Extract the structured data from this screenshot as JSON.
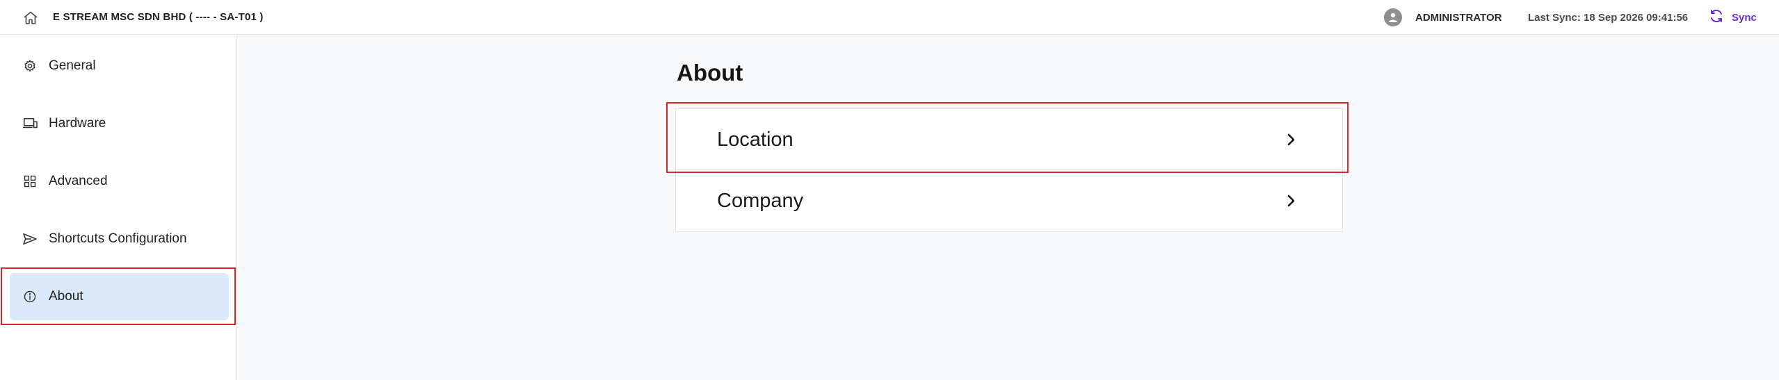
{
  "header": {
    "company_title": "E STREAM MSC SDN BHD ( ---- - SA-T01 )",
    "user_name": "ADMINISTRATOR",
    "last_sync": "Last Sync: 18 Sep 2026 09:41:56",
    "sync_label": "Sync",
    "icons": {
      "home": "home-icon",
      "avatar": "user-avatar-icon",
      "sync": "sync-icon"
    },
    "colors": {
      "sync_accent": "#6b2fd6"
    }
  },
  "sidebar": {
    "items": [
      {
        "label": "General",
        "icon": "gear-icon"
      },
      {
        "label": "Hardware",
        "icon": "devices-icon"
      },
      {
        "label": "Advanced",
        "icon": "grid-icon"
      },
      {
        "label": "Shortcuts Configuration",
        "icon": "send-icon"
      },
      {
        "label": "About",
        "icon": "info-icon",
        "active": true
      }
    ],
    "active_color": "#dbe9fb",
    "highlight_color": "#d62828"
  },
  "main": {
    "title": "About",
    "cards": [
      {
        "label": "Location",
        "icon": "chevron-right-icon",
        "highlighted": true
      },
      {
        "label": "Company",
        "icon": "chevron-right-icon"
      }
    ]
  }
}
